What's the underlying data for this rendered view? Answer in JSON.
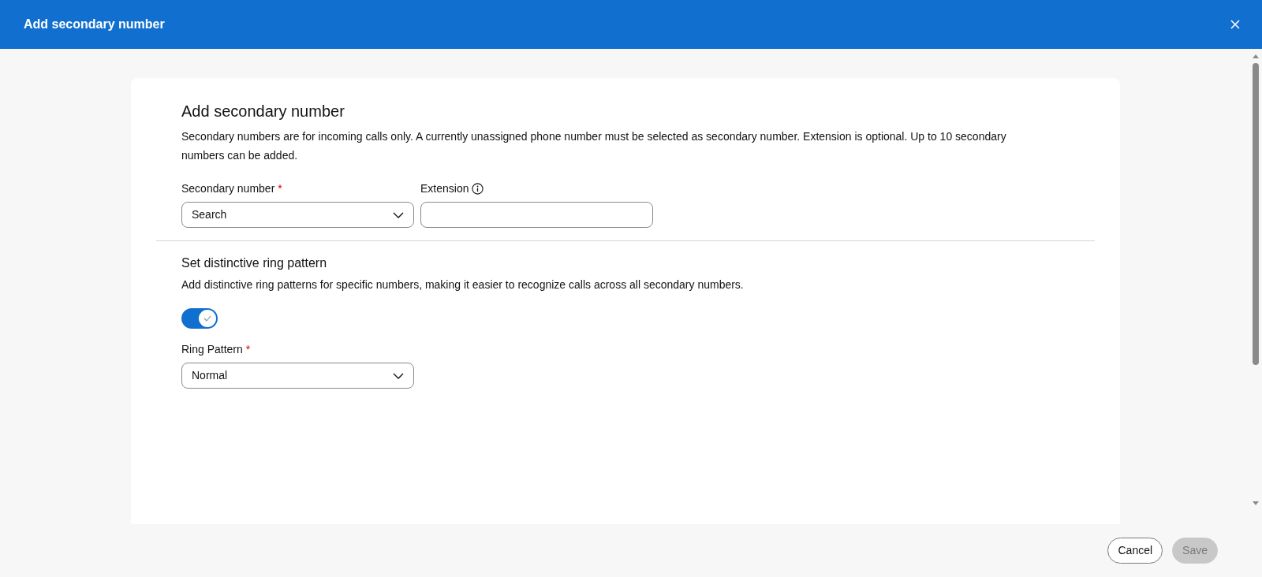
{
  "window": {
    "title": "Add secondary number"
  },
  "form": {
    "heading": "Add secondary number",
    "description": "Secondary numbers are for incoming calls only. A currently unassigned phone number must be selected as secondary number. Extension is optional. Up to 10 secondary numbers can be added.",
    "fields": [
      {
        "kind": "dropdown",
        "label": "Secondary number",
        "required_mark": "*",
        "placeholder": "Search"
      },
      {
        "kind": "text",
        "label": "Extension",
        "info": true
      }
    ]
  },
  "ring_section": {
    "heading": "Set distinctive ring pattern",
    "description": "Add distinctive ring patterns for specific numbers, making it easier to recognize calls across all secondary numbers.",
    "toggle": {
      "on": true
    },
    "ring_pattern": {
      "label": "Ring Pattern",
      "required_mark": "*",
      "value": "Normal"
    }
  },
  "buttons": [
    {
      "label": "Cancel",
      "kind": "secondary",
      "disabled": false
    },
    {
      "label": "Save",
      "kind": "primary",
      "disabled": true
    }
  ]
}
